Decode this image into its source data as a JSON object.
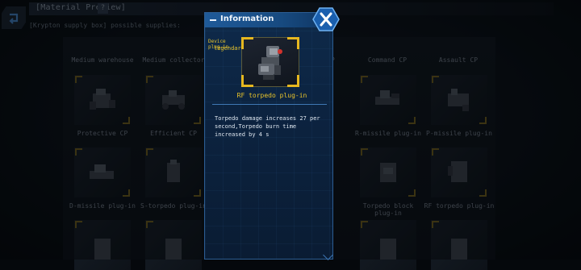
{
  "header": {
    "title": "[Material Preview]",
    "help_label": "?",
    "subtitle": "[Krypton supply box] possible supplies:"
  },
  "grid": {
    "column_labels": [
      "Medium warehouse",
      "Medium collector",
      "",
      "",
      "Command CP",
      "Assault CP"
    ],
    "rows": [
      {
        "labels": [
          "Protective CP",
          "Efficient CP",
          "",
          "",
          "R-missile plug-in",
          "P-missile plug-in"
        ]
      },
      {
        "labels": [
          "D-missile plug-in",
          "S-torpedo plug-in",
          "",
          "",
          "Torpedo block plug-in",
          "RF torpedo plug-in"
        ]
      }
    ],
    "partial_visible_label": "CP"
  },
  "info_panel": {
    "title": "Information",
    "item_type": "Device plug-in",
    "item_rarity": "legendary",
    "item_name": "RF torpedo plug-in",
    "description": "Torpedo damage increases 27 per second,Torpedo burn time increased by 4 s",
    "close_icon": "close-x-icon"
  },
  "colors": {
    "accent_gold": "#e8c32a",
    "panel_blue": "#0e2a4a",
    "header_blue": "#1f5a99",
    "text_grey": "#6d7682"
  }
}
